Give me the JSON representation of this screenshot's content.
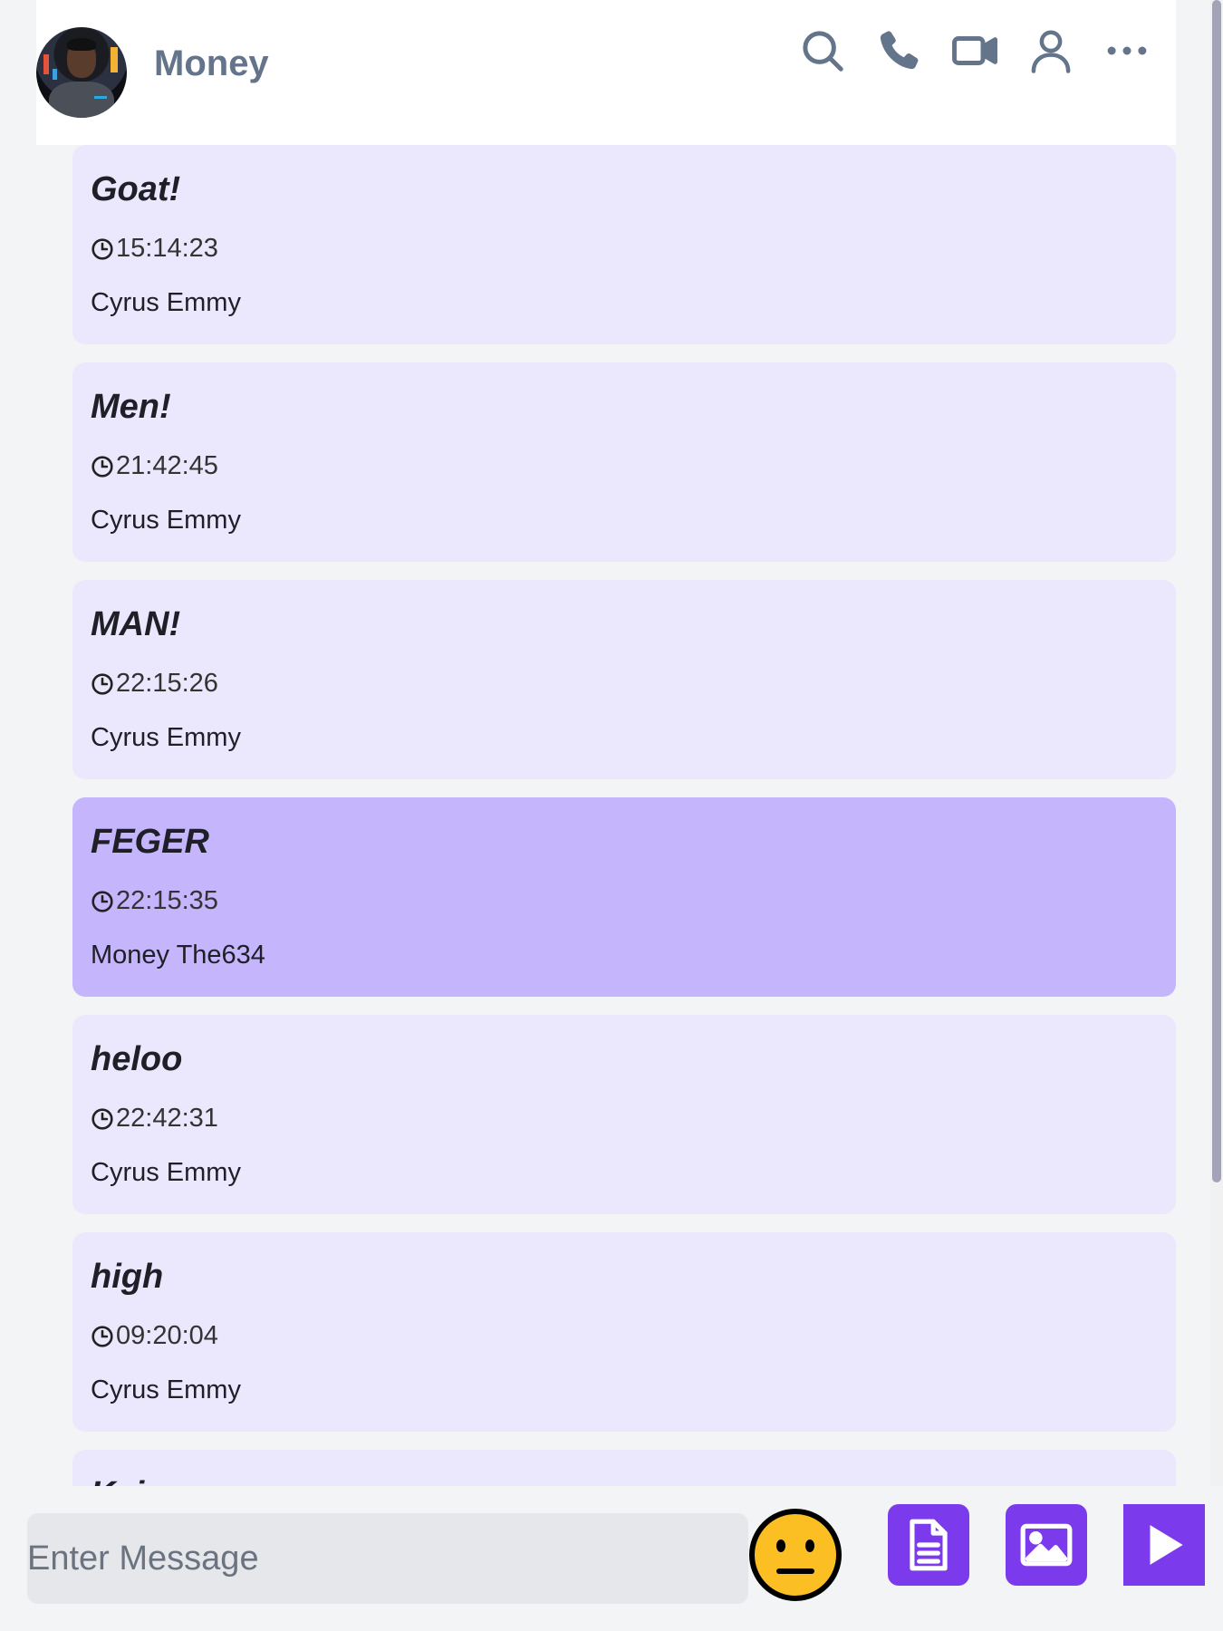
{
  "header": {
    "contact_name": "Money",
    "icons": [
      "search-icon",
      "phone-icon",
      "video-icon",
      "user-icon",
      "more-icon"
    ]
  },
  "messages": [
    {
      "text": "Goat!",
      "time": "15:14:23",
      "sender": "Cyrus Emmy",
      "mine": false
    },
    {
      "text": "Men!",
      "time": "21:42:45",
      "sender": "Cyrus Emmy",
      "mine": false
    },
    {
      "text": "MAN!",
      "time": "22:15:26",
      "sender": "Cyrus Emmy",
      "mine": false
    },
    {
      "text": "FEGER",
      "time": "22:15:35",
      "sender": "Money The634",
      "mine": true
    },
    {
      "text": "heloo",
      "time": "22:42:31",
      "sender": "Cyrus Emmy",
      "mine": false
    },
    {
      "text": "high",
      "time": "09:20:04",
      "sender": "Cyrus Emmy",
      "mine": false
    },
    {
      "text": "Kaj...",
      "time": "",
      "sender": "",
      "mine": false
    }
  ],
  "composer": {
    "placeholder": "Enter Message",
    "value": ""
  },
  "colors": {
    "accent": "#7c3aed",
    "bubble_other": "#ebe7fd",
    "bubble_mine": "#c4b5fd",
    "header_text": "#64748b"
  }
}
